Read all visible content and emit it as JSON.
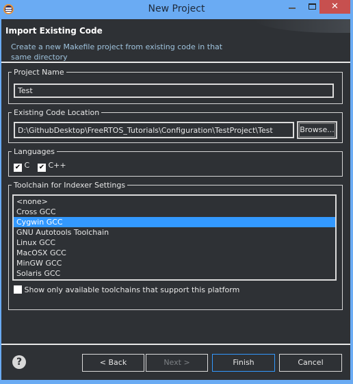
{
  "window": {
    "title": "New Project",
    "close_glyph": "✕"
  },
  "header": {
    "title": "Import Existing Code",
    "description": "Create a new Makefile project from existing code in that same directory"
  },
  "project_name": {
    "label": "Project Name",
    "value": "Test"
  },
  "code_location": {
    "label": "Existing Code Location",
    "value": "D:\\GithubDesktop\\FreeRTOS_Tutorials\\Configuration\\TestProject\\Test",
    "browse": "Browse..."
  },
  "languages": {
    "label": "Languages",
    "items": [
      {
        "label": "C",
        "checked": true
      },
      {
        "label": "C++",
        "checked": true
      }
    ]
  },
  "toolchain": {
    "label": "Toolchain for Indexer Settings",
    "items": [
      "<none>",
      "Cross GCC",
      "Cygwin GCC",
      "GNU Autotools Toolchain",
      "Linux GCC",
      "MacOSX GCC",
      "MinGW GCC",
      "Solaris GCC"
    ],
    "selected": "Cygwin GCC",
    "filter_label": "Show only available toolchains that support this platform",
    "filter_checked": false
  },
  "buttons": {
    "help": "?",
    "back": "< Back",
    "next": "Next >",
    "finish": "Finish",
    "cancel": "Cancel"
  },
  "colors": {
    "accent": "#3399ff",
    "frame": "#6aabf3",
    "background": "#2e3135",
    "close": "#c7504f"
  }
}
